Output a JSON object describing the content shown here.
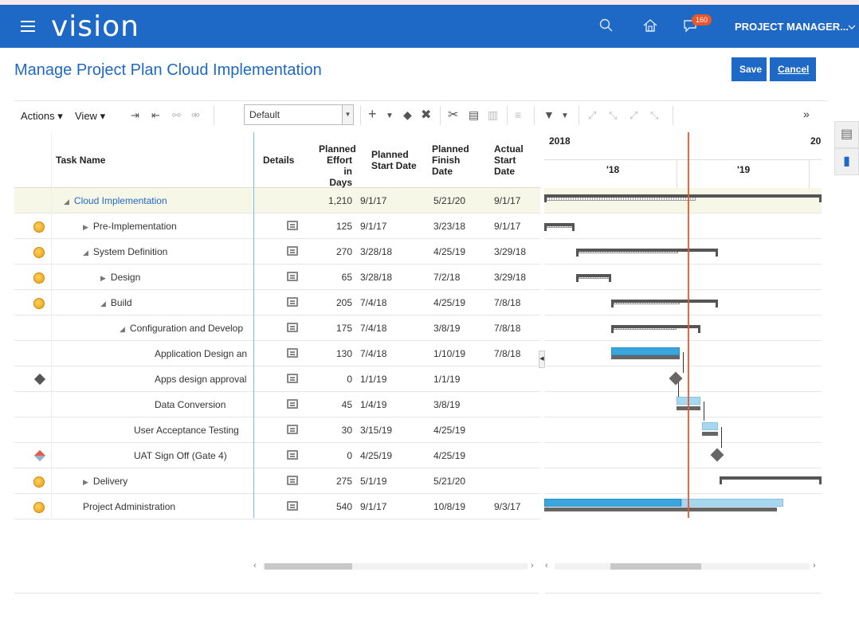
{
  "app": {
    "brand": "vision",
    "notification_count": "160",
    "user_menu": "PROJECT MANAGER..."
  },
  "page": {
    "title": "Manage Project Plan  Cloud Implementation",
    "save_label": "Save",
    "cancel_label": "Cancel"
  },
  "toolbar": {
    "actions_label": "Actions",
    "view_label": "View",
    "view_select_value": "Default",
    "overflow": "»"
  },
  "columns": {
    "task_name": "Task Name",
    "details": "Details",
    "effort": [
      "Planned",
      "Effort in",
      "Days"
    ],
    "planned_start": [
      "Planned",
      "Start Date"
    ],
    "planned_finish": [
      "Planned",
      "Finish",
      "Date"
    ],
    "actual_start": [
      "Actual",
      "Start",
      "Date"
    ]
  },
  "gantt": {
    "year_left": "2018",
    "year_right": "20",
    "period_1": "'18",
    "period_2": "'19"
  },
  "rows": [
    {
      "indent": 0,
      "toggle": "expanded",
      "name": "Cloud Implementation",
      "icon": "none",
      "effort": "1,210",
      "start": "9/1/17",
      "finish": "5/21/20",
      "actual": "9/1/17",
      "details": false,
      "link": true
    },
    {
      "indent": 1,
      "toggle": "collapsed",
      "name": "Pre-Implementation",
      "icon": "coin",
      "effort": "125",
      "start": "9/1/17",
      "finish": "3/23/18",
      "actual": "9/1/17",
      "details": true
    },
    {
      "indent": 1,
      "toggle": "expanded",
      "name": "System Definition",
      "icon": "coin",
      "effort": "270",
      "start": "3/28/18",
      "finish": "4/25/19",
      "actual": "3/29/18",
      "details": true
    },
    {
      "indent": 2,
      "toggle": "collapsed",
      "name": "Design",
      "icon": "coin",
      "effort": "65",
      "start": "3/28/18",
      "finish": "7/2/18",
      "actual": "3/29/18",
      "details": true
    },
    {
      "indent": 2,
      "toggle": "expanded",
      "name": "Build",
      "icon": "coin",
      "effort": "205",
      "start": "7/4/18",
      "finish": "4/25/19",
      "actual": "7/8/18",
      "details": true
    },
    {
      "indent": 3,
      "toggle": "expanded",
      "name": "Configuration and Develop",
      "icon": "none",
      "effort": "175",
      "start": "7/4/18",
      "finish": "3/8/19",
      "actual": "7/8/18",
      "details": true
    },
    {
      "indent": 4,
      "toggle": "none",
      "name": "Application Design an",
      "icon": "none",
      "effort": "130",
      "start": "7/4/18",
      "finish": "1/10/19",
      "actual": "7/8/18",
      "details": true
    },
    {
      "indent": 4,
      "toggle": "none",
      "name": "Apps design approval",
      "icon": "milestone",
      "effort": "0",
      "start": "1/1/19",
      "finish": "1/1/19",
      "actual": "",
      "details": true
    },
    {
      "indent": 4,
      "toggle": "none",
      "name": "Data Conversion",
      "icon": "none",
      "effort": "45",
      "start": "1/4/19",
      "finish": "3/8/19",
      "actual": "",
      "details": true
    },
    {
      "indent": 3,
      "toggle": "none",
      "name": "User Acceptance Testing",
      "icon": "none",
      "effort": "30",
      "start": "3/15/19",
      "finish": "4/25/19",
      "actual": "",
      "details": true
    },
    {
      "indent": 3,
      "toggle": "none",
      "name": "UAT Sign Off (Gate 4)",
      "icon": "milestone-red",
      "effort": "0",
      "start": "4/25/19",
      "finish": "4/25/19",
      "actual": "",
      "details": true
    },
    {
      "indent": 1,
      "toggle": "collapsed",
      "name": "Delivery",
      "icon": "coin",
      "effort": "275",
      "start": "5/1/19",
      "finish": "5/21/20",
      "actual": "",
      "details": true
    },
    {
      "indent": 1,
      "toggle": "none",
      "name": "Project Administration",
      "icon": "coin",
      "effort": "540",
      "start": "9/1/17",
      "finish": "10/8/19",
      "actual": "9/3/17",
      "details": true
    }
  ],
  "icons": [
    "menu-icon",
    "search-icon",
    "home-icon",
    "notifications-icon",
    "chevron-down-icon"
  ]
}
